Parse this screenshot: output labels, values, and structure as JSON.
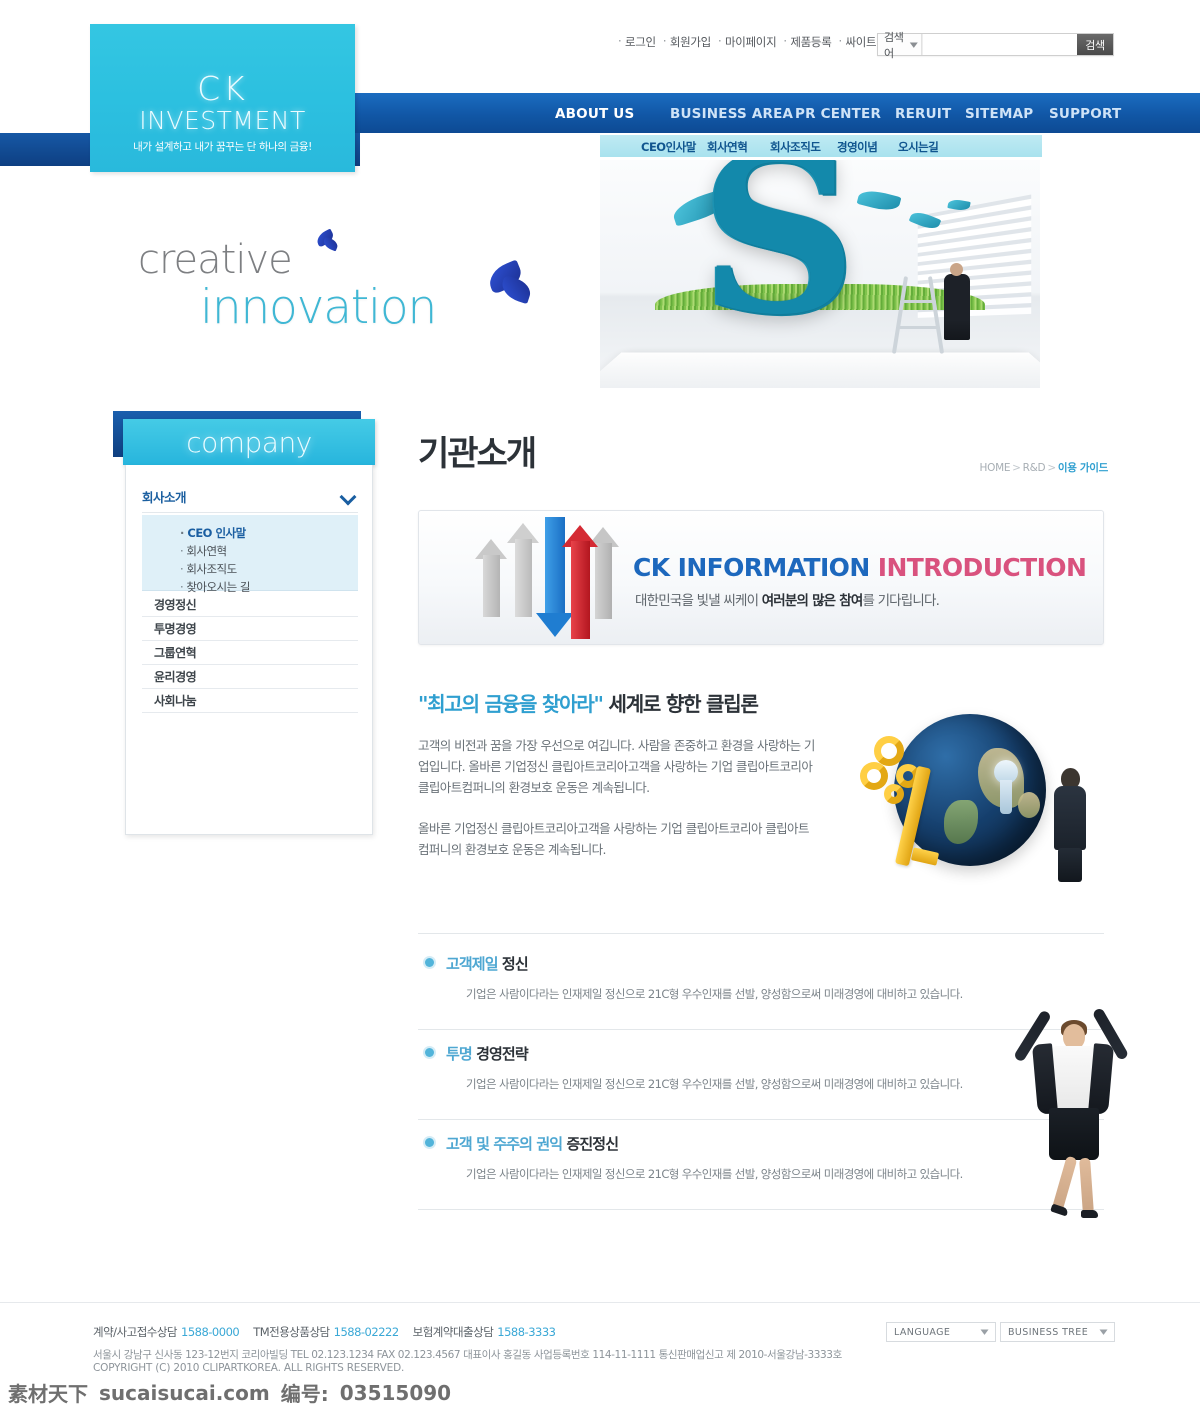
{
  "topbar": {
    "links": [
      "로그인",
      "회원가입",
      "마이페이지",
      "제품등록",
      "싸이트맵"
    ],
    "search": {
      "category": "검색어",
      "value": "",
      "placeholder": "",
      "button": "검색"
    }
  },
  "logo": {
    "line1": "CK",
    "line2": "INVESTMENT",
    "tagline": "내가 설계하고 내가 꿈꾸는 단 하나의 금융!"
  },
  "mainnav": {
    "items": [
      {
        "label": "ABOUT US",
        "active": true
      },
      {
        "label": "BUSINESS AREA",
        "active": false
      },
      {
        "label": "PR CENTER",
        "active": false
      },
      {
        "label": "RERUIT",
        "active": false
      },
      {
        "label": "SITEMAP",
        "active": false
      },
      {
        "label": "SUPPORT",
        "active": false
      }
    ]
  },
  "subnav": {
    "items": [
      "CEO인사말",
      "회사연혁",
      "회사조직도",
      "경영이념",
      "오시는길"
    ]
  },
  "hero": {
    "line1": "creative",
    "line2": "innovation"
  },
  "sidebar": {
    "title": "company",
    "section_label": "회사소개",
    "sub_items": [
      {
        "label": "CEO 인사말",
        "active": true
      },
      {
        "label": "회사연혁",
        "active": false
      },
      {
        "label": "회사조직도",
        "active": false
      },
      {
        "label": "찾아오시는 길",
        "active": false
      }
    ],
    "items": [
      "경영정신",
      "투명경영",
      "그룹연혁",
      "윤리경영",
      "사회나눔"
    ]
  },
  "main": {
    "page_title": "기관소개",
    "breadcrumb": {
      "home": "HOME",
      "mid": "R&D",
      "current": "이용 가이드"
    },
    "banner": {
      "title_blue": "CK INFORMATION",
      "title_pink": "INTRODUCTION",
      "sub_pre": "대한민국을 빛낼 씨케이 ",
      "sub_bold": "여러분의 많은 참여",
      "sub_post": "를 기다립니다."
    },
    "intro": {
      "heading_hl": "\"최고의 금융을 찾아라\"",
      "heading_rest": " 세계로 향한 클립론",
      "paragraph1": "고객의 비전과 꿈을 가장 우선으로 여깁니다. 사람을 존중하고 환경을 사랑하는 기업입니다. 올바른 기업정신 클립아트코리아고객을 사랑하는 기업 클립아트코리아 클립아트컴퍼니의 환경보호 운동은 계속됩니다.",
      "paragraph2": "올바른 기업정신 클립아트코리아고객을 사랑하는 기업 클립아트코리아 클립아트컴퍼니의 환경보호 운동은 계속됩니다."
    },
    "features": [
      {
        "heading_hl": "고객제일",
        "heading_rest": " 정신",
        "desc": "기업은 사람이다라는 인재제일 정신으로 21C형 우수인재를 선발, 양성함으로써 미래경영에 대비하고 있습니다."
      },
      {
        "heading_hl": "투명",
        "heading_rest": " 경영전략",
        "desc": "기업은 사람이다라는 인재제일 정신으로 21C형 우수인재를 선발, 양성함으로써 미래경영에 대비하고 있습니다."
      },
      {
        "heading_hl": "고객 및 주주의 권익",
        "heading_rest": " 증진정신",
        "desc": "기업은 사람이다라는 인재제일 정신으로 21C형 우수인재를 선발, 양성함으로써 미래경영에 대비하고 있습니다."
      }
    ]
  },
  "footer": {
    "tel_items": [
      {
        "label": "계약/사고접수상담",
        "number": "1588-0000"
      },
      {
        "label": "TM전용상품상담",
        "number": "1588-02222"
      },
      {
        "label": "보험계약대출상담",
        "number": "1588-3333"
      }
    ],
    "address": "서울시 강남구 신사동 123-12번지 코리아빌딩  TEL 02.123.1234   FAX 02.123.4567  대표이사 홍길동 사업등록번호 114-11-1111 통신판매업신고 제 2010-서울강남-3333호",
    "copyright": "COPYRIGHT (C) 2010 CLIPARTKOREA. ALL RIGHTS RESERVED.",
    "selects": [
      {
        "label": "LANGUAGE"
      },
      {
        "label": "BUSINESS TREE"
      }
    ]
  },
  "watermark": {
    "cn": "素材天下",
    "site": "sucaisucai.com",
    "id_label": "编号:",
    "id": "03515090"
  },
  "colors": {
    "cyan": "#2cc0e0",
    "nav_blue": "#1157a6",
    "dark_blue": "#0f3f80",
    "accent_blue": "#2f9fd0",
    "pink": "#d9527e"
  }
}
